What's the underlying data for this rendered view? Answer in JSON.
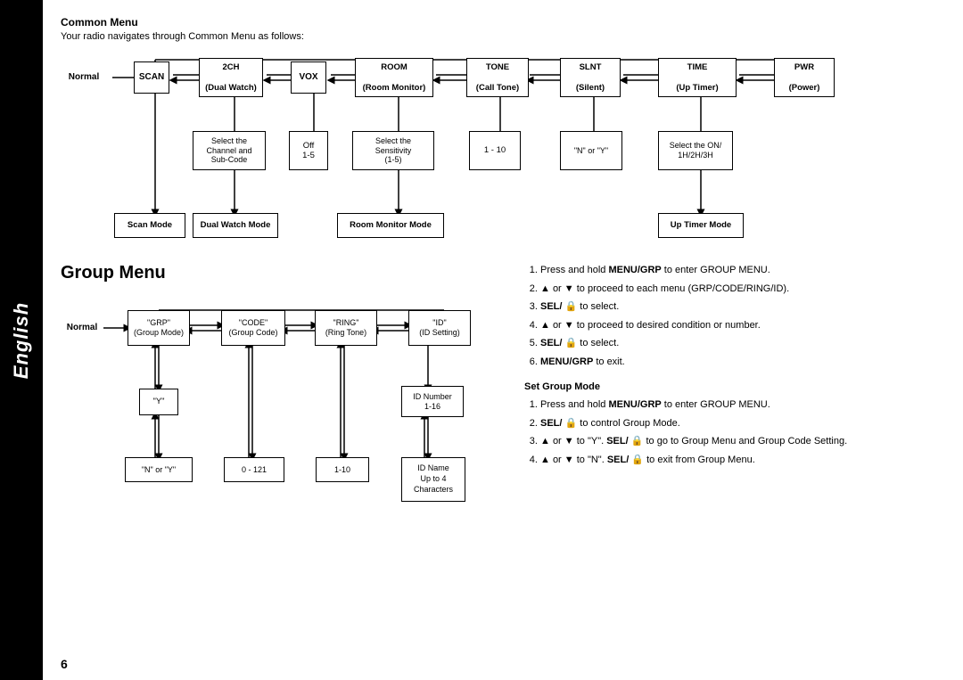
{
  "sidebar": {
    "label": "English"
  },
  "common_menu": {
    "title": "Common Menu",
    "description": "Your radio navigates through Common Menu as follows:"
  },
  "common_flow": {
    "nodes": [
      {
        "id": "normal",
        "label": "Normal"
      },
      {
        "id": "scan",
        "label": "SCAN"
      },
      {
        "id": "2ch",
        "label": "2CH\n(Dual Watch)"
      },
      {
        "id": "vox",
        "label": "VOX"
      },
      {
        "id": "room",
        "label": "ROOM\n(Room Monitor)"
      },
      {
        "id": "tone",
        "label": "TONE\n(Call Tone)"
      },
      {
        "id": "slnt",
        "label": "SLNT\n(Silent)"
      },
      {
        "id": "time",
        "label": "TIME\n(Up Timer)"
      },
      {
        "id": "pwr",
        "label": "PWR\n(Power)"
      },
      {
        "id": "select_ch",
        "label": "Select the\nChannel and\nSub-Code"
      },
      {
        "id": "off15",
        "label": "Off\n1-5"
      },
      {
        "id": "select_sens",
        "label": "Select the\nSensitivity\n(1-5)"
      },
      {
        "id": "1to10",
        "label": "1 - 10"
      },
      {
        "id": "n_or_y",
        "label": "\"N\" or \"Y\""
      },
      {
        "id": "select_on",
        "label": "Select the ON/\n1H/2H/3H"
      },
      {
        "id": "scan_mode",
        "label": "Scan Mode"
      },
      {
        "id": "dual_watch_mode",
        "label": "Dual Watch Mode"
      },
      {
        "id": "room_monitor_mode",
        "label": "Room Monitor Mode"
      },
      {
        "id": "up_timer_mode",
        "label": "Up Timer Mode"
      }
    ]
  },
  "group_menu": {
    "title": "Group Menu",
    "nodes": [
      {
        "id": "normal",
        "label": "Normal"
      },
      {
        "id": "grp",
        "label": "\"GRP\"\n(Group Mode)"
      },
      {
        "id": "code",
        "label": "\"CODE\"\n(Group Code)"
      },
      {
        "id": "ring",
        "label": "\"RING\"\n(Ring Tone)"
      },
      {
        "id": "id",
        "label": "\"ID\"\n(ID Setting)"
      },
      {
        "id": "y",
        "label": "\"Y\""
      },
      {
        "id": "id_number",
        "label": "ID Number\n1-16"
      },
      {
        "id": "n_or_y2",
        "label": "\"N\" or \"Y\""
      },
      {
        "id": "0to121",
        "label": "0 - 121"
      },
      {
        "id": "1to10g",
        "label": "1-10"
      },
      {
        "id": "id_name",
        "label": "ID Name\nUp to 4\nCharacters"
      }
    ]
  },
  "instructions": {
    "main_steps": [
      {
        "num": "1",
        "text": "Press and hold ",
        "bold": "MENU/GRP",
        "rest": " to enter GROUP MENU."
      },
      {
        "num": "2",
        "text": "▲ or ▼ to proceed to each menu (GRP/CODE/RING/ID)."
      },
      {
        "num": "3",
        "text": "SEL/ 🔒 to select."
      },
      {
        "num": "4",
        "text": "▲ or ▼ to proceed to desired condition or number."
      },
      {
        "num": "5",
        "text": "SEL/ 🔒 to select."
      },
      {
        "num": "6",
        "text": "MENU/GRP to exit."
      }
    ],
    "set_group_mode_title": "Set Group Mode",
    "set_group_steps": [
      {
        "num": "1",
        "text": "Press and hold ",
        "bold": "MENU/GRP",
        "rest": " to enter GROUP MENU."
      },
      {
        "num": "2",
        "text": "SEL/ 🔒 to control Group Mode."
      },
      {
        "num": "3",
        "text": "▲ or ▼ to \"Y\". SEL/ 🔒 to go to Group Menu and Group Code Setting."
      },
      {
        "num": "4",
        "text": "▲ or ▼ to \"N\". SEL/ 🔒 to exit from Group Menu."
      }
    ]
  },
  "page_number": "6"
}
